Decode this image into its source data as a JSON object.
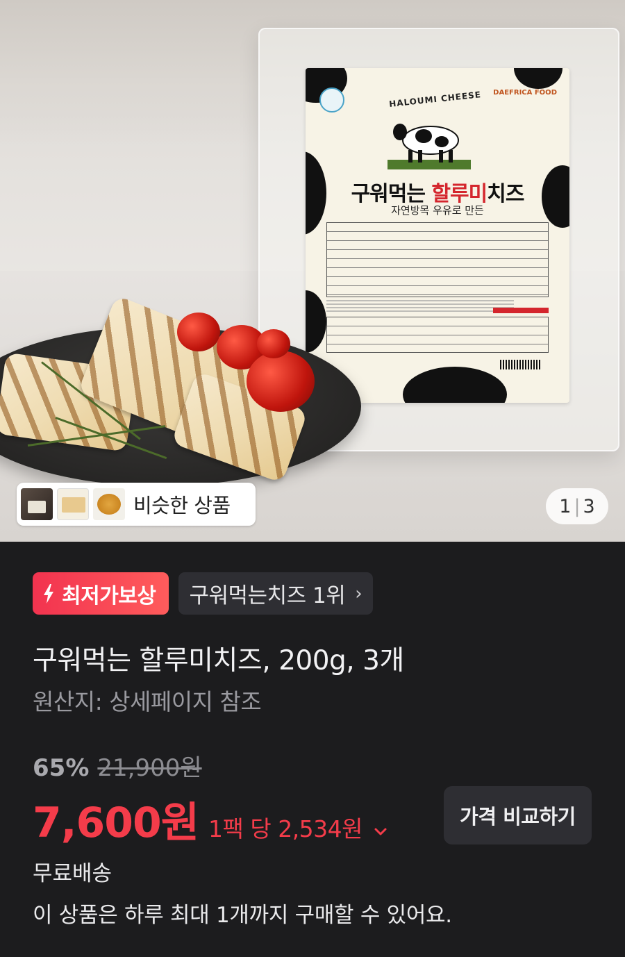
{
  "hero": {
    "package": {
      "brand": "DAEFRICA FOOD",
      "arc_text": "HALOUMI CHEESE",
      "title_black": "구워먹는 ",
      "title_red": "할루미",
      "title_black2": "치즈",
      "subtitle": "자연방목 우유로 만든"
    },
    "similar": {
      "label": "비슷한 상품",
      "thumbnails": [
        "product-thumb-1",
        "product-thumb-2",
        "product-thumb-3"
      ]
    },
    "counter": {
      "current": "1",
      "separator": "|",
      "total": "3"
    }
  },
  "info": {
    "badge_lowest": {
      "label": "최저가보상",
      "icon": "lightning-icon",
      "color": "#f2334f"
    },
    "badge_rank": {
      "label": "구워먹는치즈 1위",
      "icon": "chevron-right-icon"
    },
    "title": "구워먹는 할루미치즈, 200g, 3개",
    "origin": "원산지: 상세페이지 참조",
    "discount": "65%",
    "original_price": "21,900원",
    "price": "7,600원",
    "unit_price": "1팩 당 2,534원",
    "unit_price_icon": "chevron-down-icon",
    "compare_button": "가격 비교하기",
    "shipping": "무료배송",
    "limit_notice": "이 상품은 하루 최대 1개까지 구매할 수 있어요.",
    "accent_color": "#f43c4a"
  }
}
